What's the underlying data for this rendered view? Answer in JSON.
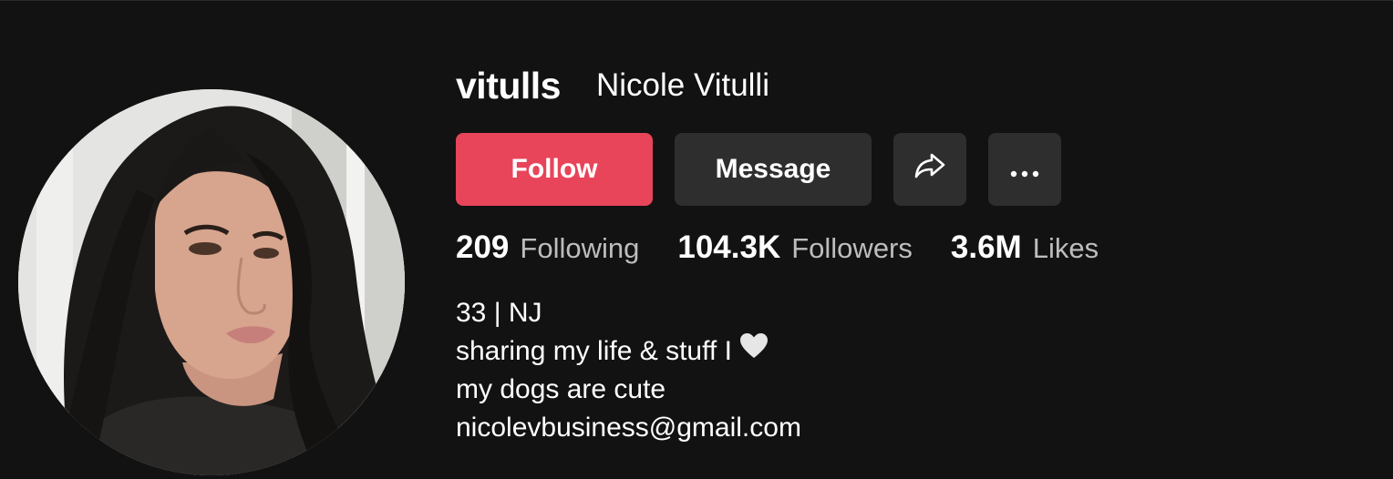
{
  "profile": {
    "handle": "vitulls",
    "display_name": "Nicole Vitulli",
    "avatar_alt": "profile photo"
  },
  "actions": {
    "follow_label": "Follow",
    "message_label": "Message",
    "share_icon": "share-arrow-icon",
    "more_icon": "more-horizontal-icon"
  },
  "stats": [
    {
      "value": "209",
      "label": "Following"
    },
    {
      "value": "104.3K",
      "label": "Followers"
    },
    {
      "value": "3.6M",
      "label": "Likes"
    }
  ],
  "bio": {
    "lines": [
      "33 | NJ",
      "sharing my life & stuff I",
      "my dogs are cute",
      "nicolevbusiness@gmail.com"
    ],
    "heart_icon": "white-heart-icon"
  },
  "colors": {
    "background": "#121212",
    "follow": "#e8445a",
    "secondary_button": "#2e2e2e",
    "muted_text": "#bdbdbd"
  }
}
